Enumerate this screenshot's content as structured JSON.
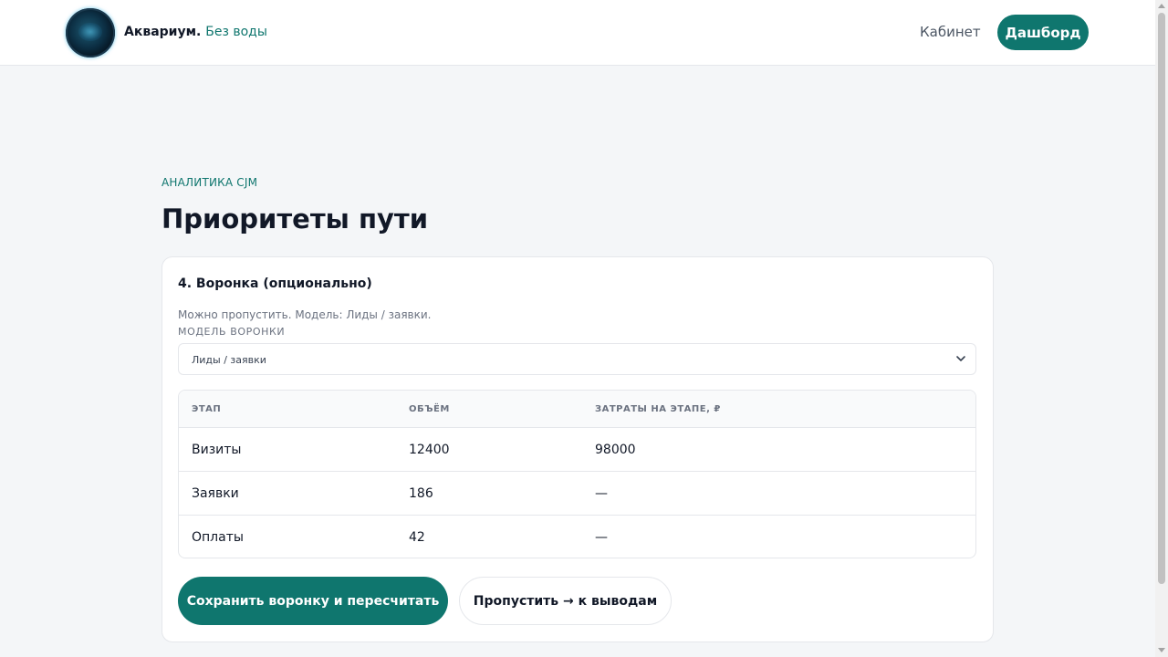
{
  "header": {
    "brand_name": "Аквариум.",
    "brand_tagline": "Без воды",
    "nav_cabinet": "Кабинет",
    "nav_dashboard": "Дашборд"
  },
  "page": {
    "eyebrow": "АНАЛИТИКА CJM",
    "title": "Приоритеты пути"
  },
  "funnel": {
    "section_title": "4. Воронка (опционально)",
    "hint": "Можно пропустить. Модель: Лиды / заявки.",
    "model_label": "МОДЕЛЬ ВОРОНКИ",
    "model_value": "Лиды / заявки",
    "columns": [
      "ЭТАП",
      "ОБЪЁМ",
      "ЗАТРАТЫ НА ЭТАПЕ, ₽"
    ],
    "rows": [
      {
        "stage": "Визиты",
        "volume": "12400",
        "cost": "98000"
      },
      {
        "stage": "Заявки",
        "volume": "186",
        "cost": "—"
      },
      {
        "stage": "Оплаты",
        "volume": "42",
        "cost": "—"
      }
    ],
    "save_button": "Сохранить воронку и пересчитать",
    "skip_button": "Пропустить → к выводам"
  },
  "colors": {
    "accent": "#0f766e",
    "background": "#f4f6f8"
  },
  "icons": {
    "logo": "aquarium-logo-icon",
    "select_chevron": "chevron-down-icon"
  }
}
